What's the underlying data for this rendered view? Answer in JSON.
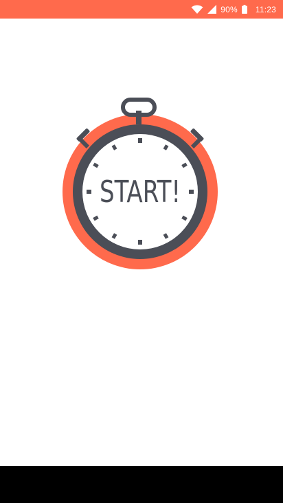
{
  "status_bar": {
    "battery_percent": "90%",
    "time": "11:23",
    "icons": [
      "wifi-icon",
      "cell-signal-icon",
      "battery-icon"
    ],
    "color": "#FF6A4C"
  },
  "main": {
    "start_button": {
      "label": "START!",
      "icon": "stopwatch-icon",
      "colors": {
        "outer_ring": "#FF6A4C",
        "bezel": "#4B4E57",
        "face": "#FFFFFF"
      }
    }
  },
  "nav_bar": {
    "color": "#000000"
  }
}
